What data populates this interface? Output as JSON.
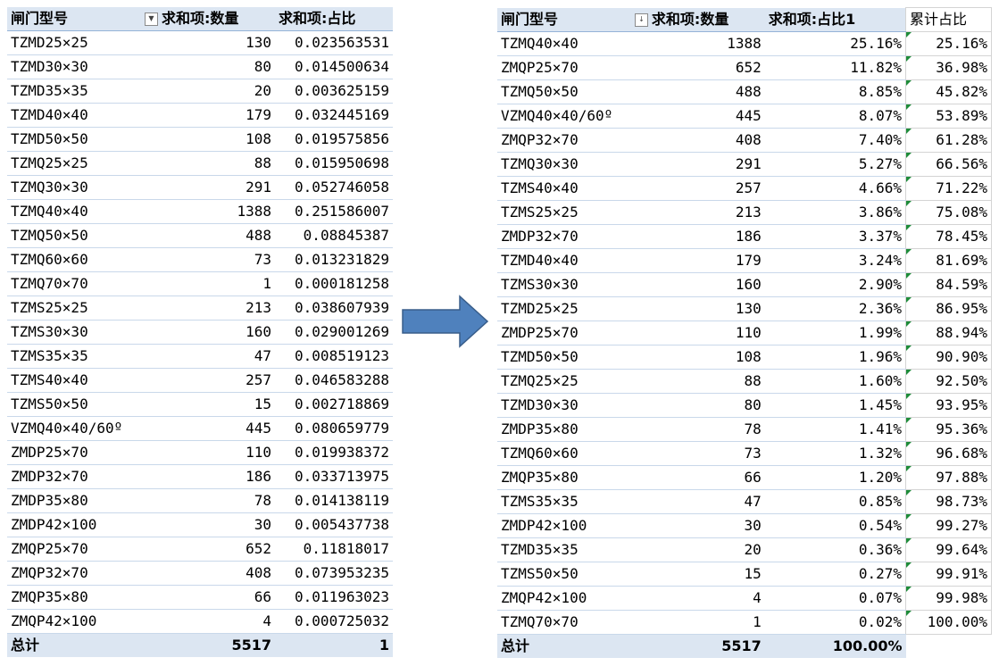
{
  "left_table": {
    "headers": [
      "闸门型号",
      "求和项:数量",
      "求和项:占比"
    ],
    "filter_icon": "dropdown-triangle",
    "rows": [
      [
        "TZMD25×25",
        "130",
        "0.023563531"
      ],
      [
        "TZMD30×30",
        "80",
        "0.014500634"
      ],
      [
        "TZMD35×35",
        "20",
        "0.003625159"
      ],
      [
        "TZMD40×40",
        "179",
        "0.032445169"
      ],
      [
        "TZMD50×50",
        "108",
        "0.019575856"
      ],
      [
        "TZMQ25×25",
        "88",
        "0.015950698"
      ],
      [
        "TZMQ30×30",
        "291",
        "0.052746058"
      ],
      [
        "TZMQ40×40",
        "1388",
        "0.251586007"
      ],
      [
        "TZMQ50×50",
        "488",
        "0.08845387"
      ],
      [
        "TZMQ60×60",
        "73",
        "0.013231829"
      ],
      [
        "TZMQ70×70",
        "1",
        "0.000181258"
      ],
      [
        "TZMS25×25",
        "213",
        "0.038607939"
      ],
      [
        "TZMS30×30",
        "160",
        "0.029001269"
      ],
      [
        "TZMS35×35",
        "47",
        "0.008519123"
      ],
      [
        "TZMS40×40",
        "257",
        "0.046583288"
      ],
      [
        "TZMS50×50",
        "15",
        "0.002718869"
      ],
      [
        "VZMQ40×40/60º",
        "445",
        "0.080659779"
      ],
      [
        "ZMDP25×70",
        "110",
        "0.019938372"
      ],
      [
        "ZMDP32×70",
        "186",
        "0.033713975"
      ],
      [
        "ZMDP35×80",
        "78",
        "0.014138119"
      ],
      [
        "ZMDP42×100",
        "30",
        "0.005437738"
      ],
      [
        "ZMQP25×70",
        "652",
        "0.11818017"
      ],
      [
        "ZMQP32×70",
        "408",
        "0.073953235"
      ],
      [
        "ZMQP35×80",
        "66",
        "0.011963023"
      ],
      [
        "ZMQP42×100",
        "4",
        "0.000725032"
      ]
    ],
    "total": [
      "总计",
      "5517",
      "1"
    ]
  },
  "right_table": {
    "headers": [
      "闸门型号",
      "求和项:数量",
      "求和项:占比1",
      "累计占比"
    ],
    "sort_icon": "sort-descending",
    "rows": [
      [
        "TZMQ40×40",
        "1388",
        "25.16%",
        "25.16%"
      ],
      [
        "ZMQP25×70",
        "652",
        "11.82%",
        "36.98%"
      ],
      [
        "TZMQ50×50",
        "488",
        "8.85%",
        "45.82%"
      ],
      [
        "VZMQ40×40/60º",
        "445",
        "8.07%",
        "53.89%"
      ],
      [
        "ZMQP32×70",
        "408",
        "7.40%",
        "61.28%"
      ],
      [
        "TZMQ30×30",
        "291",
        "5.27%",
        "66.56%"
      ],
      [
        "TZMS40×40",
        "257",
        "4.66%",
        "71.22%"
      ],
      [
        "TZMS25×25",
        "213",
        "3.86%",
        "75.08%"
      ],
      [
        "ZMDP32×70",
        "186",
        "3.37%",
        "78.45%"
      ],
      [
        "TZMD40×40",
        "179",
        "3.24%",
        "81.69%"
      ],
      [
        "TZMS30×30",
        "160",
        "2.90%",
        "84.59%"
      ],
      [
        "TZMD25×25",
        "130",
        "2.36%",
        "86.95%"
      ],
      [
        "ZMDP25×70",
        "110",
        "1.99%",
        "88.94%"
      ],
      [
        "TZMD50×50",
        "108",
        "1.96%",
        "90.90%"
      ],
      [
        "TZMQ25×25",
        "88",
        "1.60%",
        "92.50%"
      ],
      [
        "TZMD30×30",
        "80",
        "1.45%",
        "93.95%"
      ],
      [
        "ZMDP35×80",
        "78",
        "1.41%",
        "95.36%"
      ],
      [
        "TZMQ60×60",
        "73",
        "1.32%",
        "96.68%"
      ],
      [
        "ZMQP35×80",
        "66",
        "1.20%",
        "97.88%"
      ],
      [
        "TZMS35×35",
        "47",
        "0.85%",
        "98.73%"
      ],
      [
        "ZMDP42×100",
        "30",
        "0.54%",
        "99.27%"
      ],
      [
        "TZMD35×35",
        "20",
        "0.36%",
        "99.64%"
      ],
      [
        "TZMS50×50",
        "15",
        "0.27%",
        "99.91%"
      ],
      [
        "ZMQP42×100",
        "4",
        "0.07%",
        "99.98%"
      ],
      [
        "TZMQ70×70",
        "1",
        "0.02%",
        "100.00%"
      ]
    ],
    "total": [
      "总计",
      "5517",
      "100.00%"
    ]
  },
  "arrow": {
    "icon": "right-arrow-icon",
    "color": "#4f81bd",
    "border_color": "#385d8a"
  },
  "colors": {
    "header_bg": "#dce6f2",
    "row_border": "#c9d8ea",
    "green_marker": "#1e8c3a"
  }
}
